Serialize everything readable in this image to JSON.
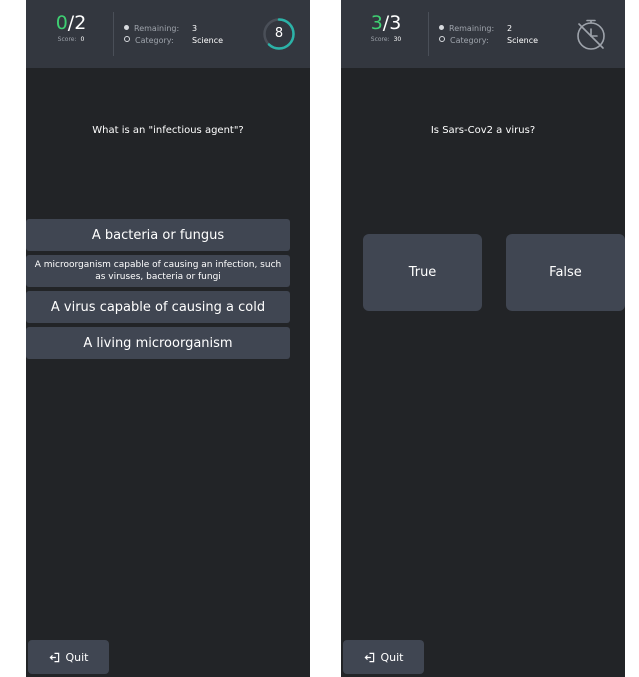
{
  "left_screen": {
    "score": {
      "answered": "0",
      "total": "2",
      "score_label": "Score:",
      "score_value": "0"
    },
    "remaining": {
      "label": "Remaining:",
      "value": "3"
    },
    "category": {
      "label": "Category:",
      "value": "Science"
    },
    "timer": {
      "value": "8",
      "fraction_remaining": 0.62,
      "ring_color": "#2bb3a8"
    },
    "question": "What is an \"infectious agent\"?",
    "answers": [
      "A bacteria or fungus",
      "A microorganism capable of causing an infection, such as viruses, bacteria or fungi",
      "A virus capable of causing a cold",
      "A living microorganism"
    ],
    "quit_label": "Quit",
    "icons": {
      "quit": "exit-icon",
      "remaining": "filled-dot-icon",
      "category": "hollow-dot-icon"
    }
  },
  "right_screen": {
    "score": {
      "answered": "3",
      "total": "3",
      "score_label": "Score:",
      "score_value": "30"
    },
    "remaining": {
      "label": "Remaining:",
      "value": "2"
    },
    "category": {
      "label": "Category:",
      "value": "Science"
    },
    "timer": {
      "state": "disabled",
      "icon": "timer-off-icon"
    },
    "question": "Is Sars-Cov2 a virus?",
    "answers": [
      "True",
      "False"
    ],
    "quit_label": "Quit",
    "icons": {
      "quit": "exit-icon",
      "remaining": "filled-dot-icon",
      "category": "hollow-dot-icon"
    }
  },
  "colors": {
    "background": "#222427",
    "header": "#33373f",
    "button": "#404652",
    "accent_green": "#3ecf72",
    "timer_ring": "#2bb3a8"
  }
}
